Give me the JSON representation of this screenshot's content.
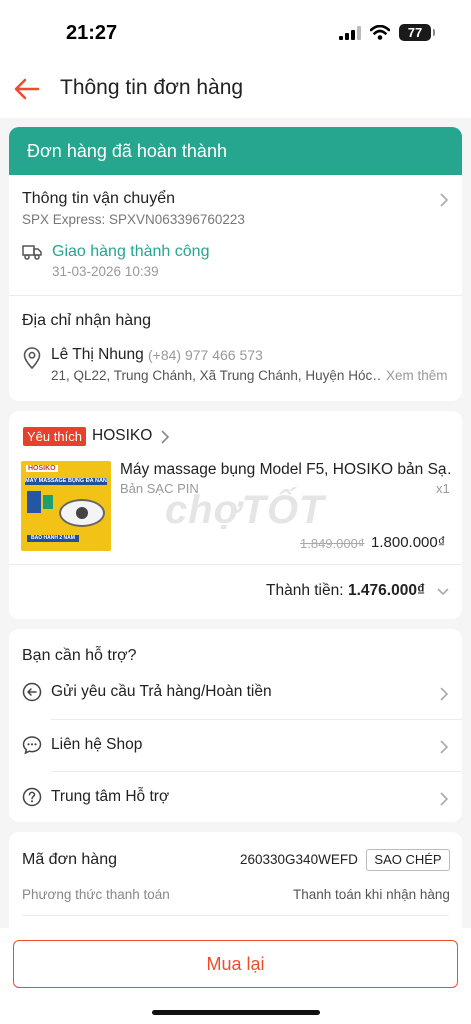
{
  "status": {
    "time": "21:27",
    "battery": "77"
  },
  "header": {
    "title": "Thông tin đơn hàng"
  },
  "order_status": {
    "banner": "Đơn hàng đã hoàn thành"
  },
  "shipping": {
    "title": "Thông tin vận chuyển",
    "carrier": "SPX Express: SPXVN063396760223",
    "status": "Giao hàng thành công",
    "date": "31-03-2026 10:39"
  },
  "address": {
    "title": "Địa chỉ nhận hàng",
    "name": "Lê Thị Nhung",
    "phone": "(+84) 977 466 573",
    "detail": "21, QL22, Trung Chánh, Xã Trung Chánh, Huyện Hóc…",
    "see_more": "Xem thêm"
  },
  "shop": {
    "badge": "Yêu thích",
    "name": "HOSIKO"
  },
  "product": {
    "name": "Máy massage bụng Model F5, HOSIKO bản Sạ…",
    "variant": "Bản SẠC PIN",
    "qty": "x1",
    "old_price": "1.849.000₫",
    "price": "1.800.000₫",
    "img_brand": "HOSIKO",
    "img_title": "MÁY MASSAGE BỤNG ĐA NĂNG",
    "img_warranty": "BẢO HÀNH 2 NĂM"
  },
  "total": {
    "label": "Thành tiền:",
    "value": "1.476.000₫"
  },
  "support": {
    "title": "Bạn cần hỗ trợ?",
    "items": [
      {
        "label": "Gửi yêu cầu Trả hàng/Hoàn tiền"
      },
      {
        "label": "Liên hệ Shop"
      },
      {
        "label": "Trung tâm Hỗ trợ"
      }
    ]
  },
  "order_info": {
    "code_label": "Mã đơn hàng",
    "code": "260330G340WEFD",
    "copy": "SAO CHÉP",
    "payment_label": "Phương thức thanh toán",
    "payment_value": "Thanh toán khi nhận hàng"
  },
  "watermark": "chợTỐT",
  "action": {
    "rebuy": "Mua lại"
  },
  "colors": {
    "accent": "#ee4d2d",
    "banner": "#26a58f",
    "success": "#26a58f"
  }
}
